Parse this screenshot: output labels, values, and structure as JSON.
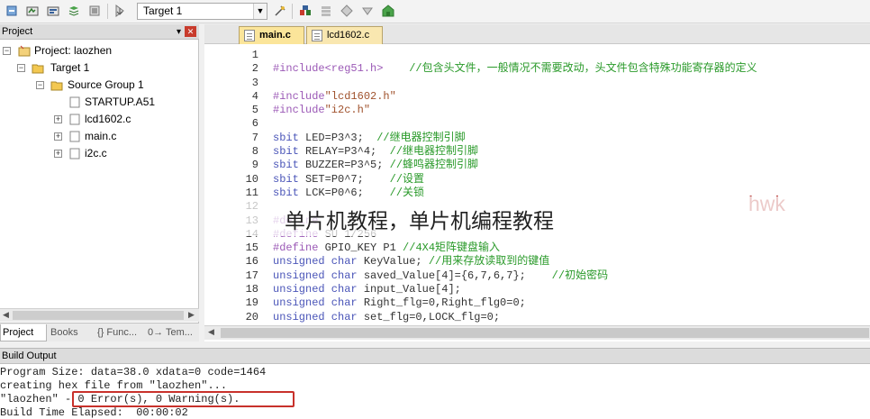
{
  "toolbar": {
    "target": "Target 1",
    "icons": [
      "translate-icon",
      "build-icon",
      "rebuild-icon",
      "batch-build-icon",
      "stop-build-icon",
      "download-icon",
      "target-options-icon",
      "file-extensions-icon",
      "manage-components-icon",
      "pack-installer-icon",
      "select-packs-icon",
      "environment-icon"
    ]
  },
  "project": {
    "header": "Project",
    "tree": {
      "project_label": "Project: laozhen",
      "target_label": "Target 1",
      "group_label": "Source Group 1",
      "files": [
        "STARTUP.A51",
        "lcd1602.c",
        "main.c",
        "i2c.c"
      ]
    },
    "tabs": [
      "Project",
      "Books",
      "{} Func...",
      "0→ Tem..."
    ]
  },
  "editor": {
    "tabs": [
      "main.c",
      "lcd1602.c"
    ],
    "line_numbers": [
      "1",
      "2",
      "3",
      "4",
      "5",
      "6",
      "7",
      "8",
      "9",
      "10",
      "11",
      "12",
      "13",
      "14",
      "15",
      "16",
      "17",
      "18",
      "19",
      "20"
    ],
    "lines": [
      [],
      [
        {
          "t": "#include<reg51.h>",
          "c": "pp"
        },
        {
          "t": "    //包含头文件，一般情况不需要改动，头文件包含特殊功能寄存器的定义",
          "c": "cm"
        }
      ],
      [],
      [
        {
          "t": "#include",
          "c": "pp"
        },
        {
          "t": "\"lcd1602.h\"",
          "c": "st"
        }
      ],
      [
        {
          "t": "#include",
          "c": "pp"
        },
        {
          "t": "\"i2c.h\"",
          "c": "st"
        }
      ],
      [],
      [
        {
          "t": "sbit",
          "c": "kw"
        },
        {
          "t": " LED=P3^3;  ",
          "c": ""
        },
        {
          "t": "//继电器控制引脚",
          "c": "cm"
        }
      ],
      [
        {
          "t": "sbit",
          "c": "kw"
        },
        {
          "t": " RELAY=P3^4;  ",
          "c": ""
        },
        {
          "t": "//继电器控制引脚",
          "c": "cm"
        }
      ],
      [
        {
          "t": "sbit",
          "c": "kw"
        },
        {
          "t": " BUZZER=P3^5; ",
          "c": ""
        },
        {
          "t": "//蜂鸣器控制引脚",
          "c": "cm"
        }
      ],
      [
        {
          "t": "sbit",
          "c": "kw"
        },
        {
          "t": " SET=P0^7;    ",
          "c": ""
        },
        {
          "t": "//设置",
          "c": "cm"
        }
      ],
      [
        {
          "t": "sbit",
          "c": "kw"
        },
        {
          "t": " LCK=P0^6;    ",
          "c": ""
        },
        {
          "t": "//关锁",
          "c": "cm"
        }
      ],
      [],
      [
        {
          "t": "#define",
          "c": "pp"
        },
        {
          "t": " ",
          "c": ""
        }
      ],
      [
        {
          "t": "#define",
          "c": "pp"
        },
        {
          "t": " SU 1/256",
          "c": ""
        }
      ],
      [
        {
          "t": "#define",
          "c": "pp"
        },
        {
          "t": " GPIO_KEY P1 ",
          "c": ""
        },
        {
          "t": "//4X4矩阵键盘输入",
          "c": "cm"
        }
      ],
      [
        {
          "t": "unsigned char",
          "c": "kw"
        },
        {
          "t": " KeyValue; ",
          "c": ""
        },
        {
          "t": "//用来存放读取到的键值",
          "c": "cm"
        }
      ],
      [
        {
          "t": "unsigned char",
          "c": "kw"
        },
        {
          "t": " saved_Value[4]={6,7,6,7};    ",
          "c": ""
        },
        {
          "t": "//初始密码",
          "c": "cm"
        }
      ],
      [
        {
          "t": "unsigned char",
          "c": "kw"
        },
        {
          "t": " input_Value[4];",
          "c": ""
        }
      ],
      [
        {
          "t": "unsigned char",
          "c": "kw"
        },
        {
          "t": " Right_flg=0,Right_flg0=0;",
          "c": ""
        }
      ],
      [
        {
          "t": "unsigned char",
          "c": "kw"
        },
        {
          "t": " set_flg=0,LOCK_flg=0;",
          "c": ""
        }
      ]
    ],
    "overlay_text": "hwk"
  },
  "watermark": "单片机教程，单片机编程教程",
  "build": {
    "header": "Build Output",
    "lines": [
      "Program Size: data=38.0 xdata=0 code=1464",
      "creating hex file from \"laozhen\"...",
      "\"laozhen\" - 0 Error(s), 0 Warning(s).",
      "Build Time Elapsed:  00:00:02"
    ]
  }
}
